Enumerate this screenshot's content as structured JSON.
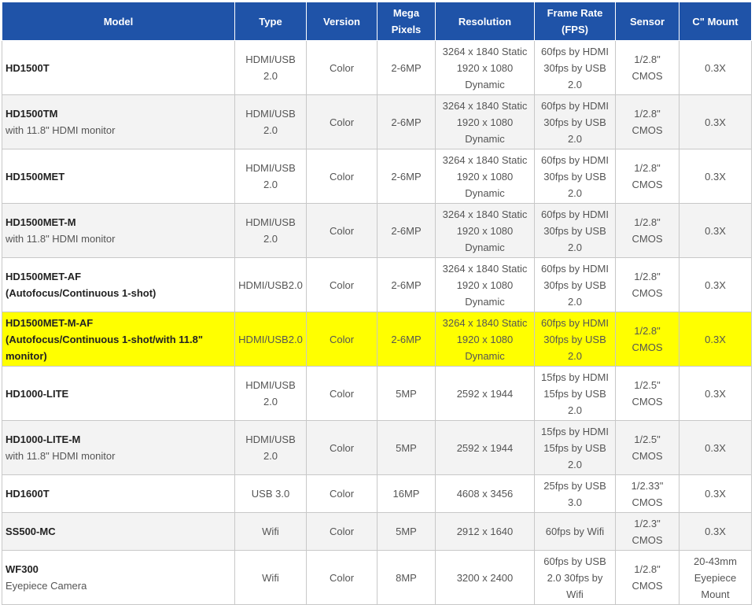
{
  "headers": [
    "Model",
    "Type",
    "Version",
    "Mega Pixels",
    "Resolution",
    "Frame Rate (FPS)",
    "Sensor",
    "C\" Mount"
  ],
  "rows": [
    {
      "model": "HD1500T",
      "sub": "",
      "type": "HDMI/USB 2.0",
      "version": "Color",
      "mp": "2-6MP",
      "resolution": "3264 x 1840 Static 1920 x 1080 Dynamic",
      "fps": "60fps by HDMI 30fps by USB 2.0",
      "sensor": "1/2.8\" CMOS",
      "mount": "0.3X"
    },
    {
      "model": "HD1500TM",
      "sub": "with 11.8\" HDMI monitor",
      "type": "HDMI/USB 2.0",
      "version": "Color",
      "mp": "2-6MP",
      "resolution": "3264 x 1840 Static 1920 x 1080 Dynamic",
      "fps": "60fps by HDMI 30fps by USB 2.0",
      "sensor": "1/2.8\" CMOS",
      "mount": "0.3X"
    },
    {
      "model": "HD1500MET",
      "sub": "",
      "type": "HDMI/USB 2.0",
      "version": "Color",
      "mp": "2-6MP",
      "resolution": "3264 x 1840 Static 1920 x 1080 Dynamic",
      "fps": "60fps by HDMI 30fps by USB 2.0",
      "sensor": "1/2.8\" CMOS",
      "mount": "0.3X"
    },
    {
      "model": "HD1500MET-M",
      "sub": "with 11.8\" HDMI monitor",
      "type": "HDMI/USB 2.0",
      "version": "Color",
      "mp": "2-6MP",
      "resolution": "3264 x 1840 Static 1920 x 1080 Dynamic",
      "fps": "60fps by HDMI 30fps by USB 2.0",
      "sensor": "1/2.8\" CMOS",
      "mount": "0.3X"
    },
    {
      "model": "HD1500MET-AF",
      "sub": "(Autofocus/Continuous 1-shot)",
      "type": "HDMI/USB2.0",
      "version": "Color",
      "mp": "2-6MP",
      "resolution": "3264 x 1840 Static 1920 x 1080 Dynamic",
      "fps": "60fps by HDMI 30fps by USB 2.0",
      "sensor": "1/2.8\" CMOS",
      "mount": "0.3X"
    },
    {
      "model": "HD1500MET-M-AF",
      "sub": "(Autofocus/Continuous 1-shot/with 11.8\" monitor)",
      "type": "HDMI/USB2.0",
      "version": "Color",
      "mp": "2-6MP",
      "resolution": "3264 x 1840 Static 1920 x 1080 Dynamic",
      "fps": "60fps by HDMI 30fps by USB 2.0",
      "sensor": "1/2.8\" CMOS",
      "mount": "0.3X"
    },
    {
      "model": "HD1000-LITE",
      "sub": "",
      "type": "HDMI/USB 2.0",
      "version": "Color",
      "mp": "5MP",
      "resolution": "2592 x 1944",
      "fps": "15fps by HDMI 15fps by USB 2.0",
      "sensor": "1/2.5\" CMOS",
      "mount": "0.3X"
    },
    {
      "model": "HD1000-LITE-M",
      "sub": "with 11.8\" HDMI monitor",
      "type": "HDMI/USB 2.0",
      "version": "Color",
      "mp": "5MP",
      "resolution": "2592 x 1944",
      "fps": "15fps by HDMI 15fps by USB 2.0",
      "sensor": "1/2.5\" CMOS",
      "mount": "0.3X"
    },
    {
      "model": "HD1600T",
      "sub": "",
      "type": "USB 3.0",
      "version": "Color",
      "mp": "16MP",
      "resolution": "4608 x 3456",
      "fps": "25fps by USB 3.0",
      "sensor": "1/2.33\" CMOS",
      "mount": "0.3X"
    },
    {
      "model": "SS500-MC",
      "sub": "",
      "type": "Wifi",
      "version": "Color",
      "mp": "5MP",
      "resolution": "2912 x 1640",
      "fps": "60fps by Wifi",
      "sensor": "1/2.3\" CMOS",
      "mount": "0.3X"
    },
    {
      "model": "WF300",
      "sub": "Eyepiece Camera",
      "type": "Wifi",
      "version": "Color",
      "mp": "8MP",
      "resolution": "3200 x 2400",
      "fps": "60fps by USB 2.0 30fps by Wifi",
      "sensor": "1/2.8\" CMOS",
      "mount": "20-43mm Eyepiece Mount"
    }
  ]
}
